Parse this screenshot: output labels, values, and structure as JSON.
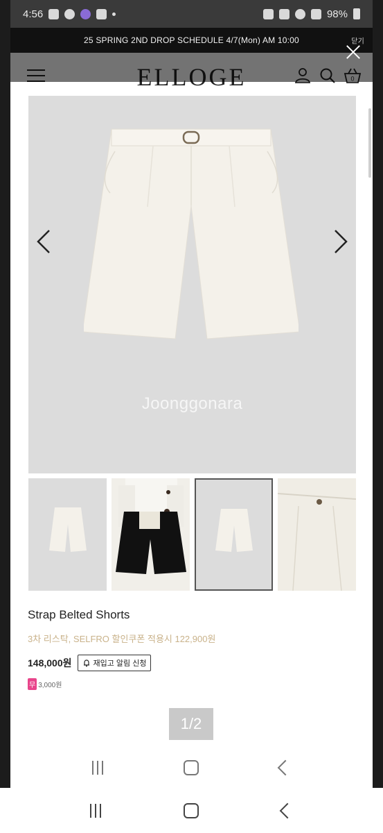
{
  "status_bar": {
    "time": "4:56",
    "battery": "98%"
  },
  "banner": {
    "text": "25 SPRING 2ND DROP SCHEDULE 4/7(Mon) AM 10:00",
    "close_label": "닫기"
  },
  "header": {
    "logo": "ELLOGE",
    "cart_count": "0"
  },
  "gallery": {
    "watermark": "Joonggonara",
    "thumbnails": [
      "product-front",
      "model-photo",
      "product-front-selected",
      "fabric-detail"
    ]
  },
  "product": {
    "name": "Strap Belted Shorts",
    "promo": "3차 리스탁, SELFRO 할인쿠폰 적용시 122,900원",
    "price": "148,000원",
    "restock_button": "재입고 알림 신청",
    "points_badge": "무",
    "points_value": "3,000원"
  },
  "pager": {
    "label": "1/2"
  },
  "icons": {
    "menu": "hamburger-icon",
    "account": "user-icon",
    "search": "search-icon",
    "cart": "basket-icon"
  }
}
